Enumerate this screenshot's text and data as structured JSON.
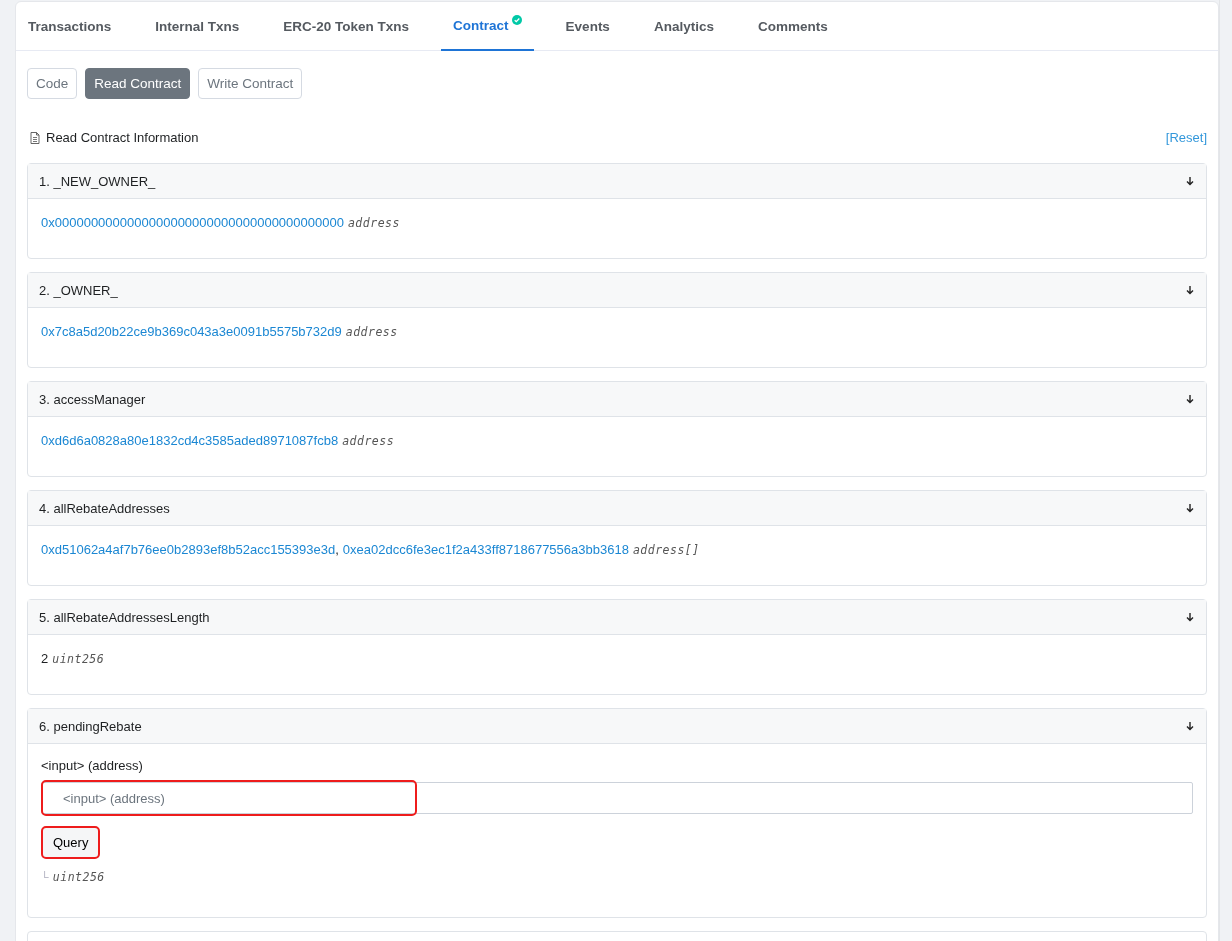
{
  "tabs": [
    {
      "label": "Transactions",
      "selected": false,
      "verified": false
    },
    {
      "label": "Internal Txns",
      "selected": false,
      "verified": false
    },
    {
      "label": "ERC-20 Token Txns",
      "selected": false,
      "verified": false
    },
    {
      "label": "Contract",
      "selected": true,
      "verified": true
    },
    {
      "label": "Events",
      "selected": false,
      "verified": false
    },
    {
      "label": "Analytics",
      "selected": false,
      "verified": false
    },
    {
      "label": "Comments",
      "selected": false,
      "verified": false
    }
  ],
  "subtabs": [
    {
      "label": "Code",
      "selected": false
    },
    {
      "label": "Read Contract",
      "selected": true
    },
    {
      "label": "Write Contract",
      "selected": false
    }
  ],
  "section": {
    "title": "Read Contract Information",
    "reset": "[Reset]"
  },
  "functions": [
    {
      "kind": "addresses",
      "title": "1. _NEW_OWNER_",
      "values": [
        "0x0000000000000000000000000000000000000000"
      ],
      "type": "address"
    },
    {
      "kind": "addresses",
      "title": "2. _OWNER_",
      "values": [
        "0x7c8a5d20b22ce9b369c043a3e0091b5575b732d9"
      ],
      "type": "address"
    },
    {
      "kind": "addresses",
      "title": "3. accessManager",
      "values": [
        "0xd6d6a0828a80e1832cd4c3585aded8971087fcb8"
      ],
      "type": "address"
    },
    {
      "kind": "addresses",
      "title": "4. allRebateAddresses",
      "values": [
        "0xd51062a4af7b76ee0b2893ef8b52acc155393e3d",
        "0xea02dcc6fe3ec1f2a433ff8718677556a3bb3618"
      ],
      "separator": ",",
      "type": "address[]"
    },
    {
      "kind": "value",
      "title": "5. allRebateAddressesLength",
      "value": "2",
      "type": "uint256"
    },
    {
      "kind": "query",
      "title": "6. pendingRebate",
      "input_label": "<input> (address)",
      "placeholder": "<input> (address)",
      "input_highlighted": true,
      "button": "Query",
      "button_highlighted": true,
      "result_mark": "└",
      "type": "uint256"
    }
  ]
}
